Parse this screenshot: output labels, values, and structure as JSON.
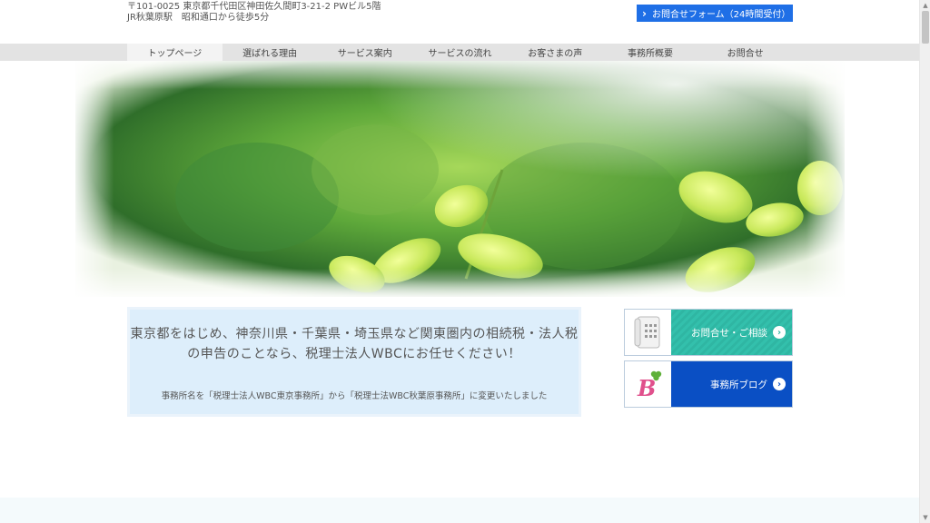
{
  "header": {
    "address_line1": "〒101-0025 東京都千代田区神田佐久間町3-21-2 PWビル5階",
    "address_line2": "JR秋葉原駅　昭和通口から徒歩5分",
    "contact_button": "お問合せフォーム（24時間受付）"
  },
  "nav": {
    "items": [
      {
        "label": "トップページ"
      },
      {
        "label": "選ばれる理由"
      },
      {
        "label": "サービス案内"
      },
      {
        "label": "サービスの流れ"
      },
      {
        "label": "お客さまの声"
      },
      {
        "label": "事務所概要"
      },
      {
        "label": "お問合せ"
      }
    ]
  },
  "notice": {
    "headline_1": "東京都をはじめ、神奈川県・千葉県・埼玉県など関東圏内の相続税・法人税",
    "headline_2": "の申告のことなら、税理士法人WBCにお任せください！",
    "sub": "事務所名を「税理士法人WBC東京事務所」から「税理士法WBC秋葉原事務所」に変更いたしました"
  },
  "sidebar": {
    "consult_label": "お問合せ・ご相談",
    "blog_label": "事務所ブログ",
    "blog_logo_letter": "B"
  },
  "colors": {
    "accent_blue": "#1f6fe6",
    "consult_teal": "#2fb6a3",
    "blog_blue": "#0a4fc4",
    "nav_bg": "#e3e3e3"
  },
  "icons": {
    "contact_chevron": "chevron-right-icon",
    "consult_arrow": "arrow-circle-right-icon",
    "blog_arrow": "arrow-circle-right-icon",
    "phone_image": "telephone-icon",
    "blog_logo": "clover-b-logo"
  }
}
